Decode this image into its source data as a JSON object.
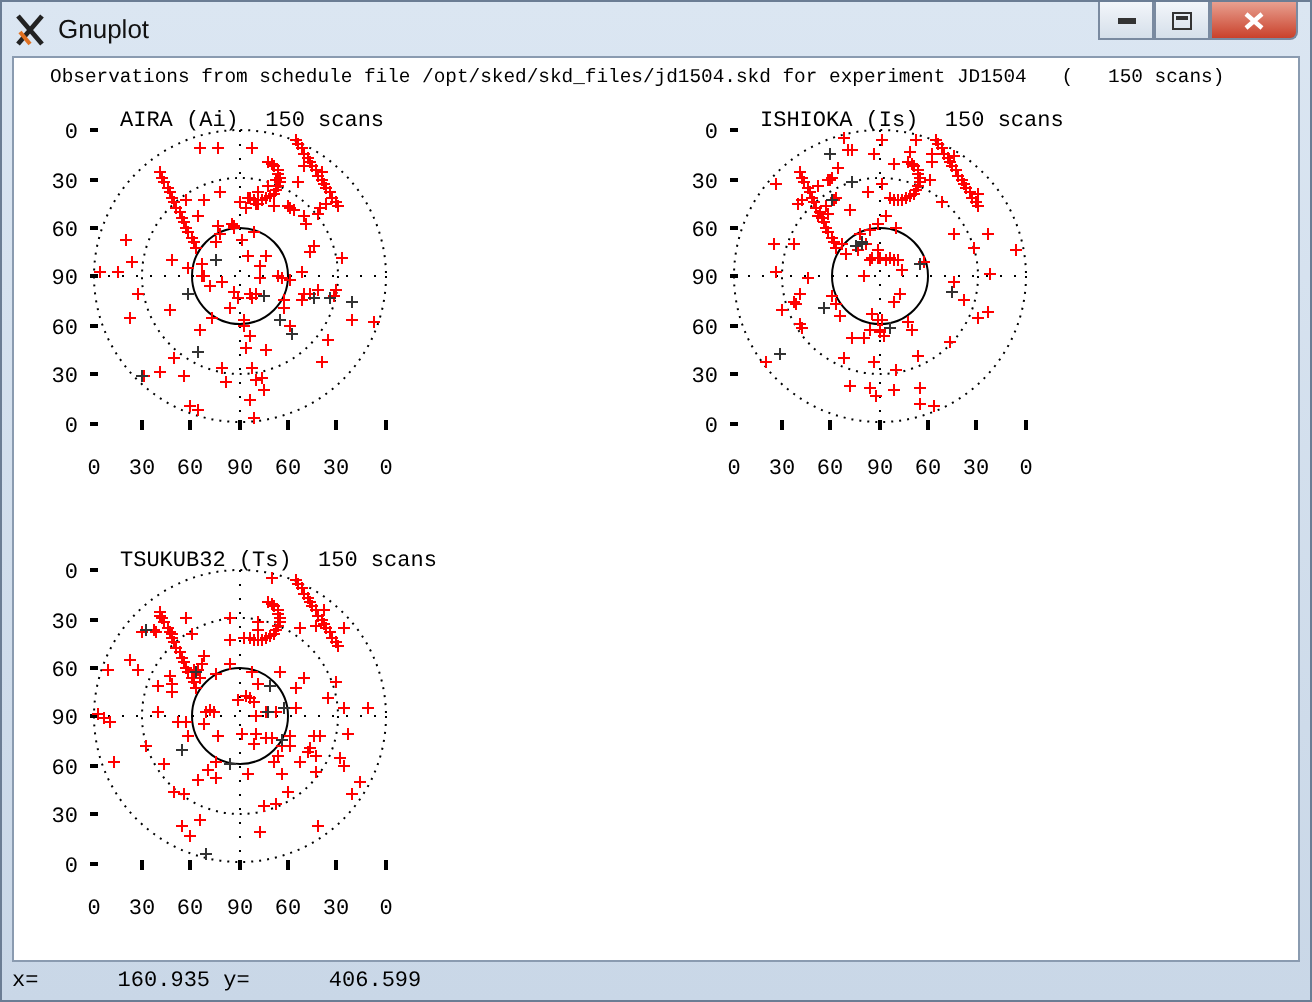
{
  "window": {
    "title": "Gnuplot"
  },
  "header": "Observations from schedule file /opt/sked/skd_files/jd1504.skd for experiment JD1504   (   150 scans)",
  "plots": [
    {
      "title": "AIRA (Ai)  150 scans",
      "y_ticks": [
        "0",
        "30",
        "60",
        "90",
        "60",
        "30",
        "0"
      ],
      "x_ticks": [
        "0",
        "30",
        "60",
        "90",
        "60",
        "30",
        "0"
      ]
    },
    {
      "title": "ISHIOKA (Is)  150 scans",
      "y_ticks": [
        "0",
        "30",
        "60",
        "90",
        "60",
        "30",
        "0"
      ],
      "x_ticks": [
        "0",
        "30",
        "60",
        "90",
        "60",
        "30",
        "0"
      ]
    },
    {
      "title": "TSUKUB32 (Ts)  150 scans",
      "y_ticks": [
        "0",
        "30",
        "60",
        "90",
        "60",
        "30",
        "0"
      ],
      "x_ticks": [
        "0",
        "30",
        "60",
        "90",
        "60",
        "30",
        "0"
      ]
    }
  ],
  "status_bar": "x=      160.935 y=      406.599"
}
